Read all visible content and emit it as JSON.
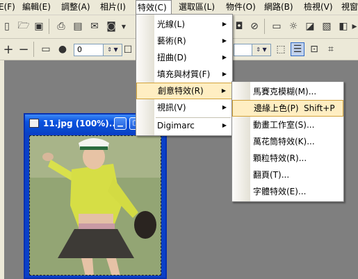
{
  "menubar": {
    "items": [
      {
        "label": "E(F)"
      },
      {
        "label": "編輯(E)"
      },
      {
        "label": "調整(A)"
      },
      {
        "label": "相片(I)"
      },
      {
        "label": "特效(C)"
      },
      {
        "label": "選取區(L)"
      },
      {
        "label": "物件(O)"
      },
      {
        "label": "網路(B)"
      },
      {
        "label": "檢視(V)"
      },
      {
        "label": "視窗"
      }
    ]
  },
  "toolbar2": {
    "zoom_value": "0"
  },
  "effects_menu": {
    "items": [
      {
        "label": "光線(L)"
      },
      {
        "label": "藝術(R)"
      },
      {
        "label": "扭曲(D)"
      },
      {
        "label": "填充與材質(F)"
      },
      {
        "label": "創意特效(R)"
      },
      {
        "label": "視訊(V)"
      },
      {
        "label": "Digimarc"
      }
    ]
  },
  "creative_submenu": {
    "items": [
      {
        "label": "馬賽克模糊(M)..."
      },
      {
        "label": "邊緣上色(P)",
        "shortcut": "Shift+P"
      },
      {
        "label": "動畫工作室(S)..."
      },
      {
        "label": "萬花筒特效(K)..."
      },
      {
        "label": "顆粒特效(R)..."
      },
      {
        "label": "翻頁(T)..."
      },
      {
        "label": "字體特效(E)..."
      }
    ]
  },
  "document_window": {
    "title": "11.jpg (100%)..."
  },
  "colors": {
    "menu_highlight": "#ffeec2",
    "menu_highlight_border": "#d2a23a",
    "titlebar": "#0a52e0",
    "workspace": "#7f7f7f"
  }
}
